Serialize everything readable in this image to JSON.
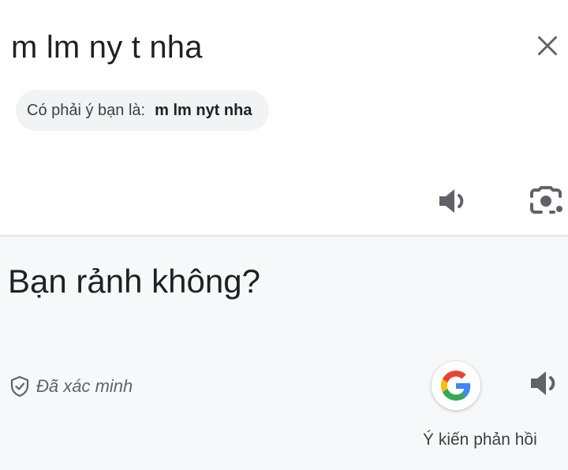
{
  "source": {
    "text": "m lm ny t nha",
    "suggestion_prefix": "Có phải ý bạn là:",
    "suggestion_term": "m lm nyt nha"
  },
  "target": {
    "text": "Bạn rảnh không?",
    "verified_label": "Đã xác minh",
    "feedback_label": "Ý kiến phản hồi"
  },
  "icons": {
    "clear": "close-icon",
    "source_speak": "volume-icon",
    "camera": "camera-lens-icon",
    "verified": "shield-check-icon",
    "google": "google-g-icon",
    "target_speak": "volume-icon"
  },
  "colors": {
    "text": "#202124",
    "icon": "#5f6368",
    "google_blue": "#4285F4",
    "google_red": "#EA4335",
    "google_yellow": "#FBBC05",
    "google_green": "#34A853"
  }
}
